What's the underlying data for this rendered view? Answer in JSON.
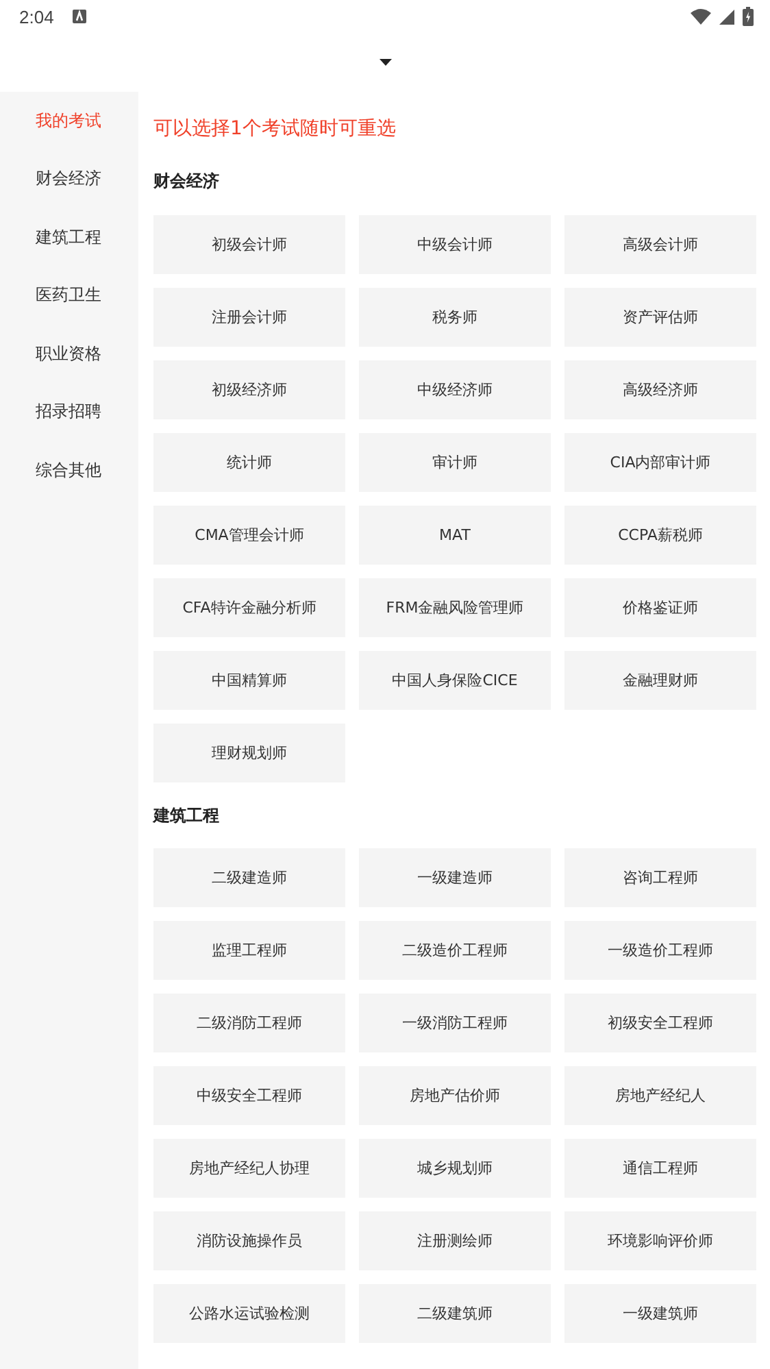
{
  "status_bar": {
    "time": "2:04"
  },
  "sidebar": {
    "items": [
      {
        "label": "我的考试",
        "selected": true
      },
      {
        "label": "财会经济",
        "selected": false
      },
      {
        "label": "建筑工程",
        "selected": false
      },
      {
        "label": "医药卫生",
        "selected": false
      },
      {
        "label": "职业资格",
        "selected": false
      },
      {
        "label": "招录招聘",
        "selected": false
      },
      {
        "label": "综合其他",
        "selected": false
      }
    ]
  },
  "hint": "可以选择1个考试随时可重选",
  "sections": [
    {
      "title": "财会经济",
      "exams": [
        "初级会计师",
        "中级会计师",
        "高级会计师",
        "注册会计师",
        "税务师",
        "资产评估师",
        "初级经济师",
        "中级经济师",
        "高级经济师",
        "统计师",
        "审计师",
        "CIA内部审计师",
        "CMA管理会计师",
        "MAT",
        "CCPA薪税师",
        "CFA特许金融分析师",
        "FRM金融风险管理师",
        "价格鉴证师",
        "中国精算师",
        "中国人身保险CICE",
        "金融理财师",
        "理财规划师"
      ]
    },
    {
      "title": "建筑工程",
      "exams": [
        "二级建造师",
        "一级建造师",
        "咨询工程师",
        "监理工程师",
        "二级造价工程师",
        "一级造价工程师",
        "二级消防工程师",
        "一级消防工程师",
        "初级安全工程师",
        "中级安全工程师",
        "房地产估价师",
        "房地产经纪人",
        "房地产经纪人协理",
        "城乡规划师",
        "通信工程师",
        "消防设施操作员",
        "注册测绘师",
        "环境影响评价师",
        "公路水运试验检测",
        "二级建筑师",
        "一级建筑师"
      ]
    }
  ]
}
